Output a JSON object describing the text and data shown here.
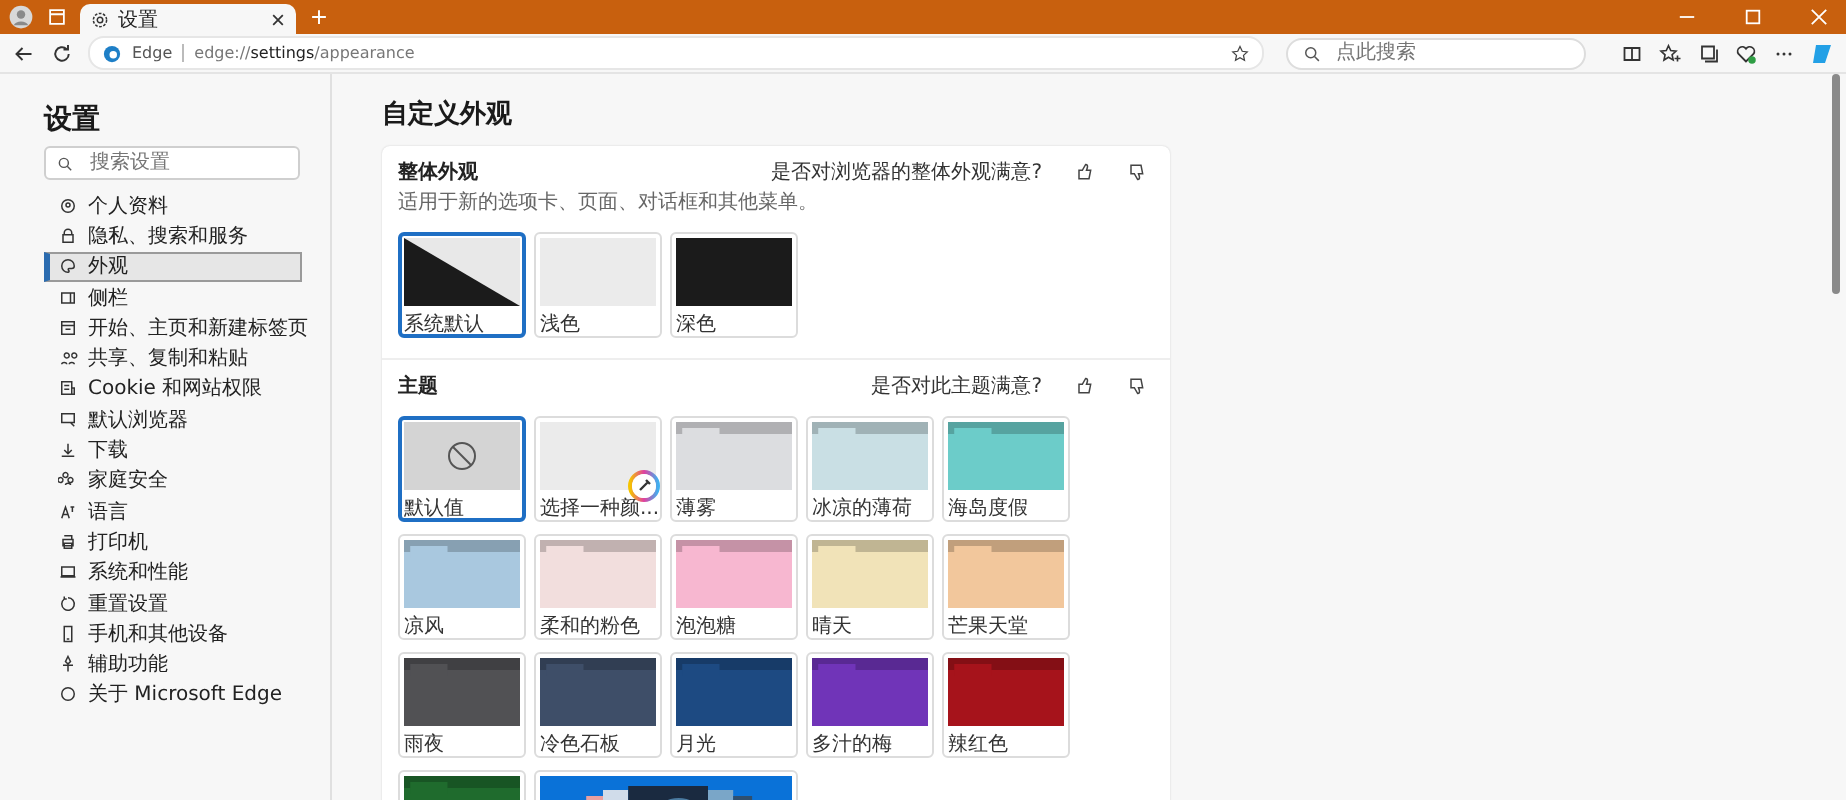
{
  "tab": {
    "title": "设置"
  },
  "address_bar": {
    "site_label": "Edge",
    "url": "edge://**settings**/appearance"
  },
  "search": {
    "placeholder": "点此搜索"
  },
  "sidebar": {
    "title": "设置",
    "search_placeholder": "搜索设置",
    "items": [
      {
        "label": "个人资料",
        "selected": false
      },
      {
        "label": "隐私、搜索和服务",
        "selected": false
      },
      {
        "label": "外观",
        "selected": true
      },
      {
        "label": "侧栏",
        "selected": false
      },
      {
        "label": "开始、主页和新建标签页",
        "selected": false
      },
      {
        "label": "共享、复制和粘贴",
        "selected": false
      },
      {
        "label": "Cookie 和网站权限",
        "selected": false
      },
      {
        "label": "默认浏览器",
        "selected": false
      },
      {
        "label": "下载",
        "selected": false
      },
      {
        "label": "家庭安全",
        "selected": false
      },
      {
        "label": "语言",
        "selected": false
      },
      {
        "label": "打印机",
        "selected": false
      },
      {
        "label": "系统和性能",
        "selected": false
      },
      {
        "label": "重置设置",
        "selected": false
      },
      {
        "label": "手机和其他设备",
        "selected": false
      },
      {
        "label": "辅助功能",
        "selected": false
      },
      {
        "label": "关于 Microsoft Edge",
        "selected": false
      }
    ]
  },
  "page_title": "自定义外观",
  "overall": {
    "title": "整体外观",
    "subtitle": "适用于新的选项卡、页面、对话框和其他菜单。",
    "feedback": "是否对浏览器的整体外观满意?",
    "options": [
      {
        "label": "系统默认",
        "kind": "system",
        "selected": true
      },
      {
        "label": "浅色",
        "kind": "light",
        "selected": false
      },
      {
        "label": "深色",
        "kind": "dark",
        "selected": false
      }
    ]
  },
  "themes": {
    "title": "主题",
    "feedback": "是否对此主题满意?",
    "items": [
      {
        "label": "默认值",
        "kind": "default",
        "selected": true
      },
      {
        "label": "选择一种颜...",
        "kind": "custom",
        "selected": false
      },
      {
        "label": "薄雾",
        "kind": "color",
        "color": "#dcdde0",
        "selected": false
      },
      {
        "label": "冰凉的薄荷",
        "kind": "color",
        "color": "#c9dfe4",
        "selected": false
      },
      {
        "label": "海岛度假",
        "kind": "color",
        "color": "#6cccc9",
        "selected": false
      },
      {
        "label": "凉风",
        "kind": "color",
        "color": "#a9c8df",
        "selected": false
      },
      {
        "label": "柔和的粉色",
        "kind": "color",
        "color": "#f2dedd",
        "selected": false
      },
      {
        "label": "泡泡糖",
        "kind": "color",
        "color": "#f7b7d0",
        "selected": false
      },
      {
        "label": "晴天",
        "kind": "color",
        "color": "#f1e3b8",
        "selected": false
      },
      {
        "label": "芒果天堂",
        "kind": "color",
        "color": "#f2c79c",
        "selected": false
      },
      {
        "label": "雨夜",
        "kind": "color",
        "color": "#515154",
        "selected": false
      },
      {
        "label": "冷色石板",
        "kind": "color",
        "color": "#3e4e68",
        "selected": false
      },
      {
        "label": "月光",
        "kind": "color",
        "color": "#1d4a82",
        "selected": false
      },
      {
        "label": "多汁的梅",
        "kind": "color",
        "color": "#7034b8",
        "selected": false
      },
      {
        "label": "辣红色",
        "kind": "color",
        "color": "#a6131b",
        "selected": false
      },
      {
        "kind": "color",
        "color": "#1f6b2d",
        "selected": false
      },
      {
        "kind": "image",
        "selected": false
      }
    ]
  }
}
